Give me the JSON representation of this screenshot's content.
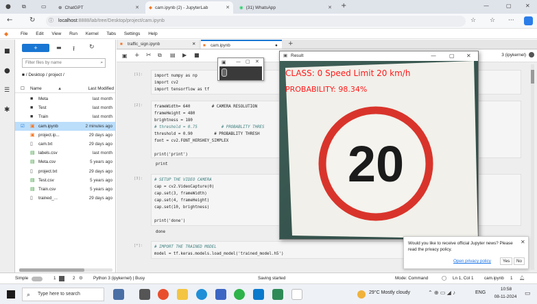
{
  "browser": {
    "tabs": [
      {
        "label": "ChatGPT"
      },
      {
        "label": "cam.ipynb (2) - JupyterLab"
      },
      {
        "label": "(31) WhatsApp"
      }
    ],
    "url_host": "localhost",
    "url_path": ":8888/lab/tree/Desktop/project/cam.ipynb"
  },
  "menu": [
    "File",
    "Edit",
    "View",
    "Run",
    "Kernel",
    "Tabs",
    "Settings",
    "Help"
  ],
  "file_browser": {
    "filter_placeholder": "Filter files by name",
    "breadcrumb": "/ Desktop / project /",
    "col_name": "Name",
    "col_modified": "Last Modified",
    "items": [
      {
        "name": "Meta",
        "modified": "last month",
        "icon": "folder-icon"
      },
      {
        "name": "Test",
        "modified": "last month",
        "icon": "folder-icon"
      },
      {
        "name": "Train",
        "modified": "last month",
        "icon": "folder-icon"
      },
      {
        "name": "cam.ipynb",
        "modified": "2 minutes ago",
        "icon": "notebook-icon",
        "selected": true
      },
      {
        "name": "project.ip...",
        "modified": "29 days ago",
        "icon": "notebook-icon"
      },
      {
        "name": "cam.txt",
        "modified": "29 days ago",
        "icon": "text-file-icon"
      },
      {
        "name": "labels.csv",
        "modified": "last month",
        "icon": "csv-icon"
      },
      {
        "name": "Meta.csv",
        "modified": "5 years ago",
        "icon": "csv-icon"
      },
      {
        "name": "project.txt",
        "modified": "29 days ago",
        "icon": "text-file-icon"
      },
      {
        "name": "Test.csv",
        "modified": "5 years ago",
        "icon": "csv-icon"
      },
      {
        "name": "Train.csv",
        "modified": "5 years ago",
        "icon": "csv-icon"
      },
      {
        "name": "trained_...",
        "modified": "29 days ago",
        "icon": "file-icon"
      }
    ]
  },
  "notebook": {
    "tabs": [
      {
        "label": "traffic_sign.ipynb"
      },
      {
        "label": "cam.ipynb"
      }
    ],
    "kernel": "3 (ipykernel)",
    "cells": [
      {
        "prompt": "[1]:",
        "lines": [
          "import numpy as np",
          "import cv2",
          "import tensorflow as tf"
        ]
      },
      {
        "prompt": "[2]:",
        "lines": [
          "frameWidth= 640         # CAMERA RESOLUTION",
          "frameHeight = 480",
          "brightness = 180",
          "# threshold = 0.75          # PROBABLITY THRES",
          "threshold = 0.90         # PROBABLITY THRESH",
          "font = cv2.FONT_HERSHEY_SIMPLEX",
          "",
          "print('print')"
        ],
        "output": "print"
      },
      {
        "prompt": "[3]:",
        "lines": [
          "# SETUP THE VIDEO CAMERA",
          "cap = cv2.VideoCapture(0)",
          "cap.set(3, frameWidth)",
          "cap.set(4, frameHeight)",
          "cap.set(10, brightness)",
          "",
          "print('done')"
        ],
        "output": "done"
      },
      {
        "prompt": "[*]:",
        "lines": [
          "# IMPORT THE TRAINED MODEL",
          "model = tf.keras.models.load_model('trained_model.h5')"
        ]
      }
    ]
  },
  "result_window": {
    "title": "Result",
    "class_text": "CLASS:  0 Speed Limit 20 km/h",
    "probability_text": "PROBABILITY: 98.34%",
    "sign_number": "20"
  },
  "notification": {
    "message": "Would you like to receive official Jupyter news? Please read the privacy policy.",
    "link": "Open privacy policy",
    "yes": "Yes",
    "no": "No"
  },
  "status": {
    "mode_label": "Simple",
    "terminals": "1",
    "kernels": "2",
    "kernel_status": "Python 3 (ipykernel) | Busy",
    "saving": "Saving started",
    "mode": "Mode: Command",
    "position": "Ln 1, Col 1",
    "file": "cam.ipynb",
    "bell": "1"
  },
  "taskbar": {
    "search_placeholder": "Type here to search",
    "weather": "29°C  Mostly cloudy",
    "lang": "ENG",
    "time": "10:58",
    "date": "08-11-2024"
  },
  "colors": {
    "accent": "#1a73e8",
    "sign_red": "#d9342b",
    "overlay_text": "#ff1a1a"
  }
}
